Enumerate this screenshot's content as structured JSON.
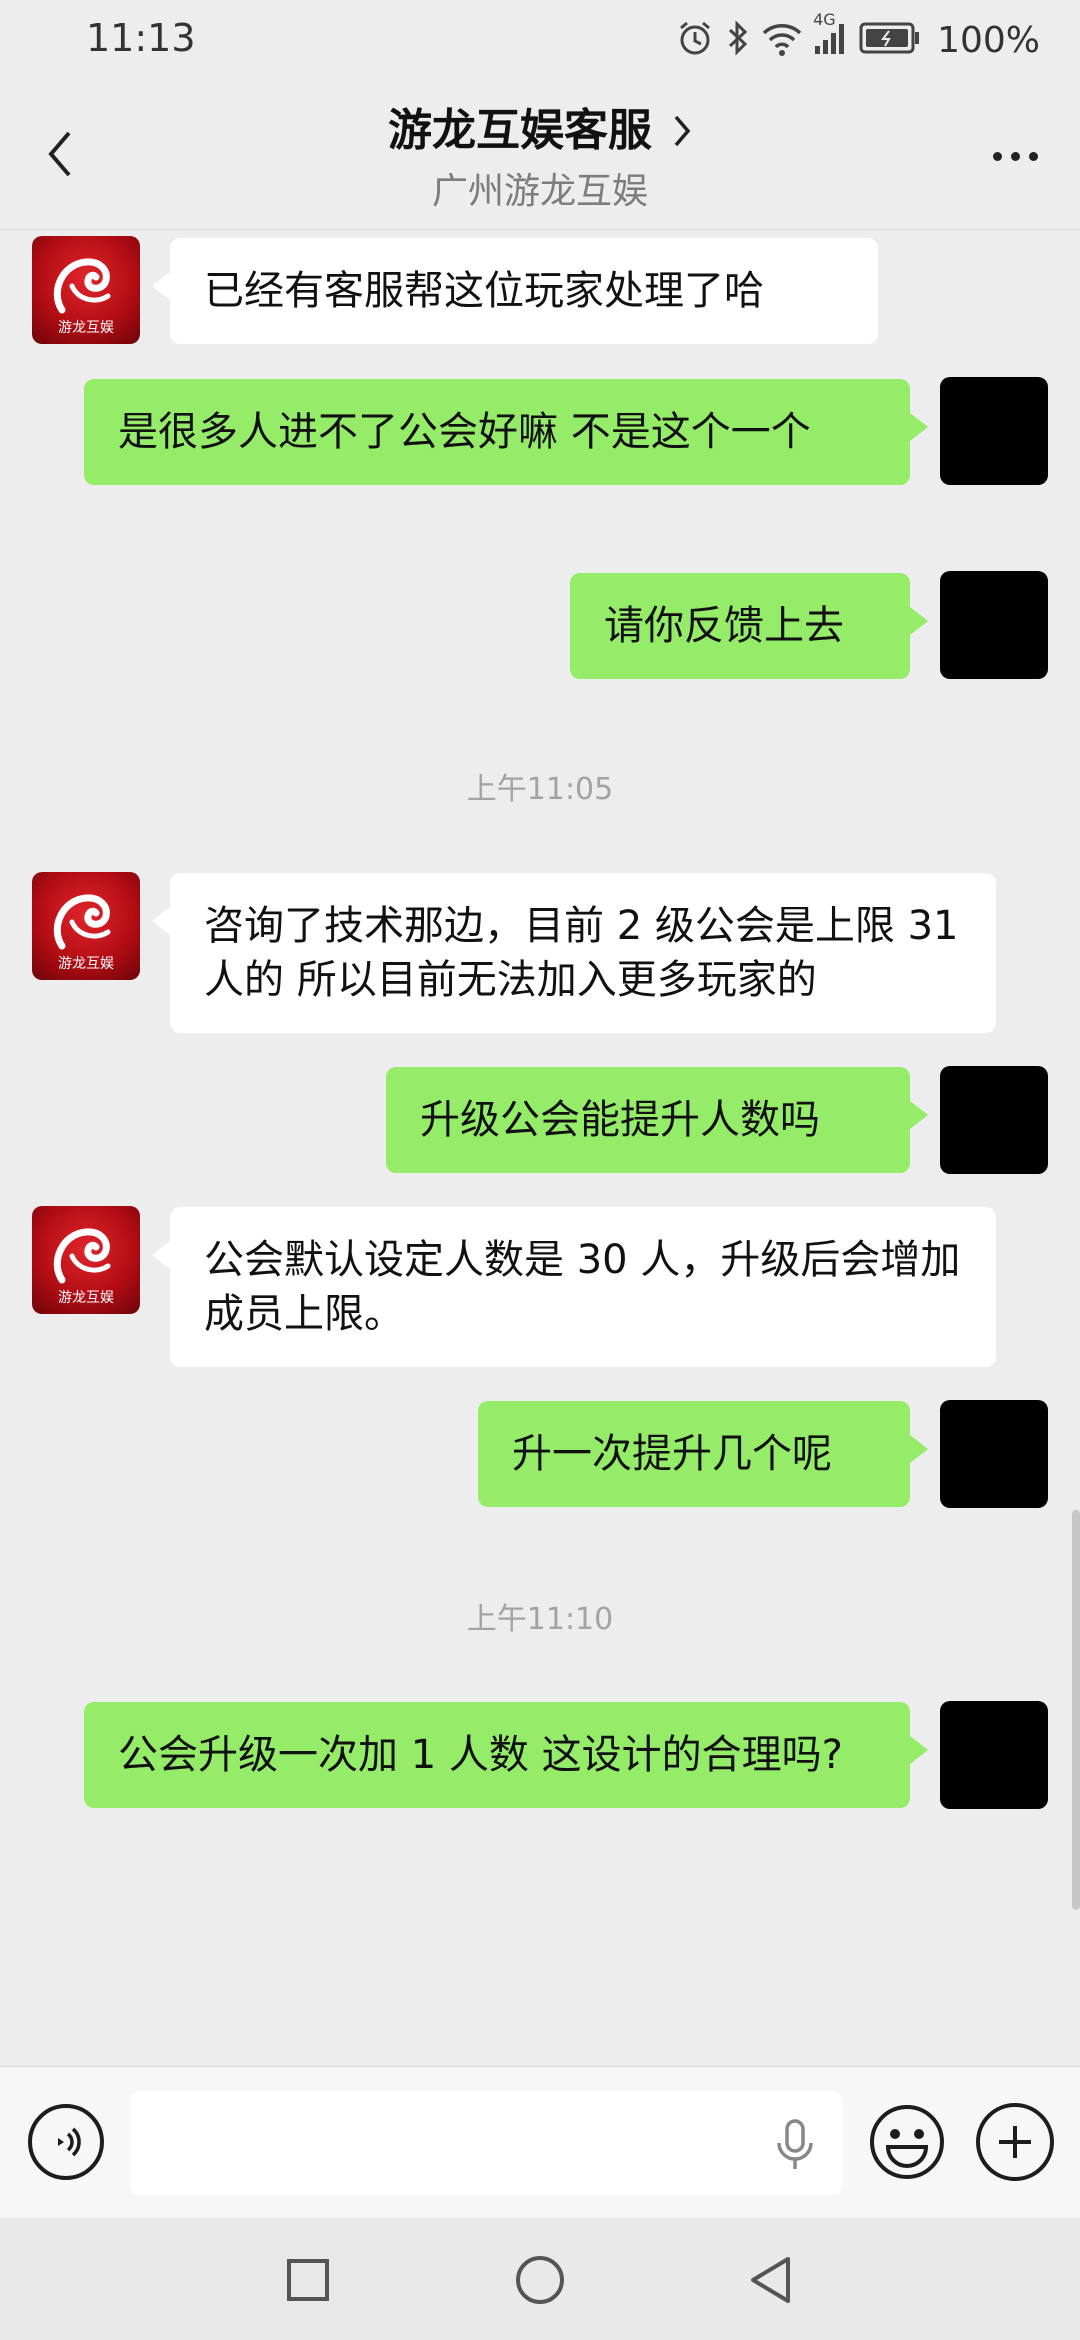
{
  "status_bar": {
    "time": "11:13",
    "battery_percent": "100%",
    "network_badge": "4G",
    "icons": [
      "alarm-icon",
      "bluetooth-icon",
      "wifi-icon",
      "cellular-signal-icon",
      "battery-icon"
    ]
  },
  "header": {
    "title": "游龙互娱客服",
    "subtitle": "广州游龙互娱",
    "back_icon": "chevron-left-icon",
    "more_icon": "more-dots-icon"
  },
  "avatar_bot_text": "游龙互娱",
  "messages": [
    {
      "side": "left",
      "text": "已经有客服帮这位玩家处理了哈"
    },
    {
      "side": "right",
      "text": "是很多人进不了公会好嘛  不是这个一个"
    },
    {
      "side": "right",
      "text": "请你反馈上去"
    },
    {
      "side": "left",
      "text": "咨询了技术那边，目前 2 级公会是上限 31 人的 所以目前无法加入更多玩家的"
    },
    {
      "side": "right",
      "text": "升级公会能提升人数吗"
    },
    {
      "side": "left",
      "text": "公会默认设定人数是 30 人，升级后会增加成员上限。"
    },
    {
      "side": "right",
      "text": "升一次提升几个呢"
    },
    {
      "side": "right",
      "text": "公会升级一次加 1 人数 这设计的合理吗?"
    }
  ],
  "timestamps": [
    "上午11:05",
    "上午11:10"
  ],
  "input_bar": {
    "placeholder": "",
    "icons": [
      "voice-icon",
      "mic-icon",
      "emoji-icon",
      "plus-icon"
    ]
  },
  "nav_bar": {
    "icons": [
      "recents-square-icon",
      "home-circle-icon",
      "back-triangle-icon"
    ]
  },
  "colors": {
    "background": "#ededed",
    "sent_bubble": "#95ec69",
    "received_bubble": "#ffffff",
    "bot_avatar": "#c4121a"
  }
}
